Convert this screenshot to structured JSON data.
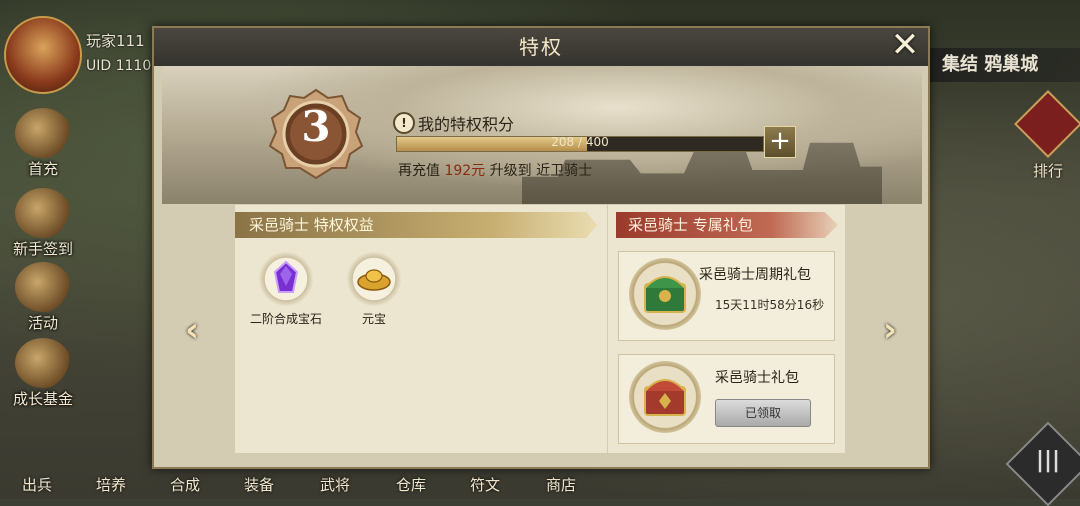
{
  "player": {
    "name": "玩家111",
    "uid": "UID 1110"
  },
  "left_menu": [
    {
      "label": "首充",
      "icon": "first-recharge-icon"
    },
    {
      "label": "新手签到",
      "icon": "signin-icon"
    },
    {
      "label": "活动",
      "icon": "event-icon"
    },
    {
      "label": "成长基金",
      "icon": "growth-fund-icon"
    }
  ],
  "bottom_menu": [
    "出兵",
    "培养",
    "合成",
    "装备",
    "武将",
    "仓库",
    "符文",
    "商店"
  ],
  "right_hud": {
    "rally": "集结 鸦巢城",
    "rank": "排行"
  },
  "dialog": {
    "title": "特权",
    "level": "3",
    "points_title": "我的特权积分",
    "points_current": 208,
    "points_max": 400,
    "points_text": "208 / 400",
    "recharge_prefix": "再充值",
    "recharge_amount": "192元",
    "recharge_mid": "升级到",
    "recharge_target": "近卫骑士",
    "benefits_header": "采邑骑士 特权权益",
    "benefits": [
      {
        "label": "二阶合成宝石",
        "icon": "purple-gem-icon"
      },
      {
        "label": "元宝",
        "icon": "gold-ingot-icon"
      }
    ],
    "gift_header": "采邑骑士 专属礼包",
    "gifts": [
      {
        "title": "采邑骑士周期礼包",
        "timer": "15天11时58分16秒",
        "icon": "green-chest-icon"
      },
      {
        "title": "采邑骑士礼包",
        "button": "已领取",
        "icon": "red-chest-icon"
      }
    ]
  },
  "colors": {
    "accent_gold": "#b58f4a",
    "header_red": "#9a3a2c",
    "panel_bg": "#ece5d0"
  }
}
